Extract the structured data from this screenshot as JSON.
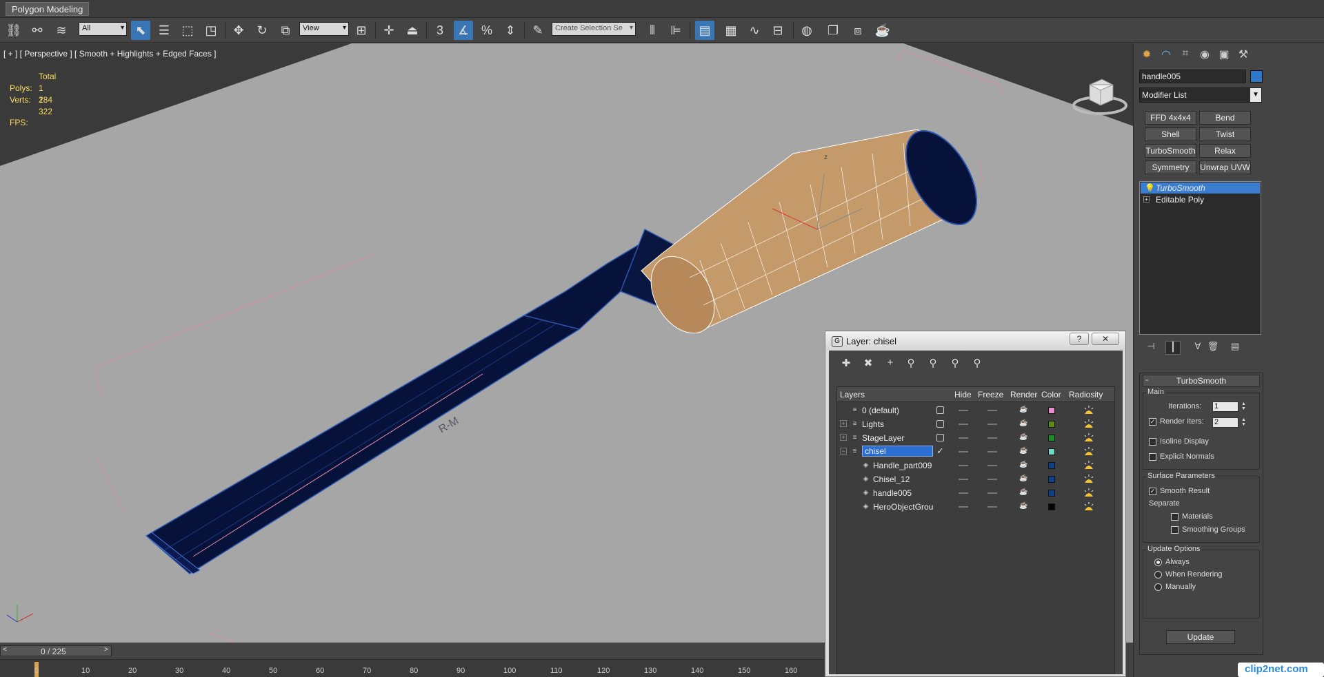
{
  "window": {
    "ribbon_tab": "Polygon Modeling"
  },
  "toolbar": {
    "selection_filter": "All",
    "reference_coord": "View",
    "named_selection_placeholder": "Create Selection Se",
    "snap_label": "3"
  },
  "viewport": {
    "label": "[ + ] [ Perspective ] [ Smooth + Highlights + Edged Faces ]",
    "stats": {
      "header": "Total",
      "polys_label": "Polys:",
      "polys_value": "1 284",
      "verts_label": "Verts:",
      "verts_value": "1 322",
      "fps_label": "FPS:"
    },
    "chisel_marking": "R-M",
    "gizmo_axis_label": "z"
  },
  "command_panel": {
    "object_name": "handle005",
    "object_color": "#2e77c9",
    "modifier_list_label": "Modifier List",
    "modifier_buttons": [
      "FFD 4x4x4",
      "Bend",
      "Shell",
      "Twist",
      "TurboSmooth",
      "Relax",
      "Symmetry",
      "Unwrap UVW"
    ],
    "stack": [
      {
        "label": "TurboSmooth",
        "selected": true
      },
      {
        "label": "Editable Poly",
        "selected": false
      }
    ],
    "turbosmooth": {
      "title": "TurboSmooth",
      "main_group": "Main",
      "iterations_label": "Iterations:",
      "iterations_value": "1",
      "render_iters_label": "Render Iters:",
      "render_iters_value": "2",
      "render_iters_checked": true,
      "isoline_display": "Isoline Display",
      "explicit_normals": "Explicit Normals",
      "surface_group": "Surface Parameters",
      "smooth_result": "Smooth Result",
      "separate_label": "Separate",
      "materials": "Materials",
      "smoothing_groups": "Smoothing Groups",
      "update_group": "Update Options",
      "always": "Always",
      "when_rendering": "When Rendering",
      "manually": "Manually",
      "update_button": "Update"
    }
  },
  "layer_dialog": {
    "title": "Layer: chisel",
    "help": "?",
    "close": "✕",
    "columns": [
      "Layers",
      "Hide",
      "Freeze",
      "Render",
      "Color",
      "Radiosity"
    ],
    "rows": [
      {
        "name": "0 (default)",
        "indent": 0,
        "color": "#e48fd0",
        "expander": ""
      },
      {
        "name": "Lights",
        "indent": 0,
        "color": "#5c8b15",
        "expander": "+"
      },
      {
        "name": "StageLayer",
        "indent": 0,
        "color": "#1b8c2c",
        "expander": "+"
      },
      {
        "name": "chisel",
        "indent": 0,
        "color": "#73d7c7",
        "expander": "−",
        "selected": true
      },
      {
        "name": "Handle_part009",
        "indent": 1,
        "color": "#113f8a"
      },
      {
        "name": "Chisel_12",
        "indent": 1,
        "color": "#113f8a"
      },
      {
        "name": "handle005",
        "indent": 1,
        "color": "#113f8a"
      },
      {
        "name": "HeroObjectGrou",
        "indent": 1,
        "color": "#050505"
      }
    ]
  },
  "timeline": {
    "frame_label": "0 / 225",
    "ticks": [
      "0",
      "10",
      "20",
      "30",
      "40",
      "50",
      "60",
      "70",
      "80",
      "90",
      "100",
      "110",
      "120",
      "130",
      "140",
      "150",
      "160"
    ]
  },
  "watermark": "clip2net.com"
}
